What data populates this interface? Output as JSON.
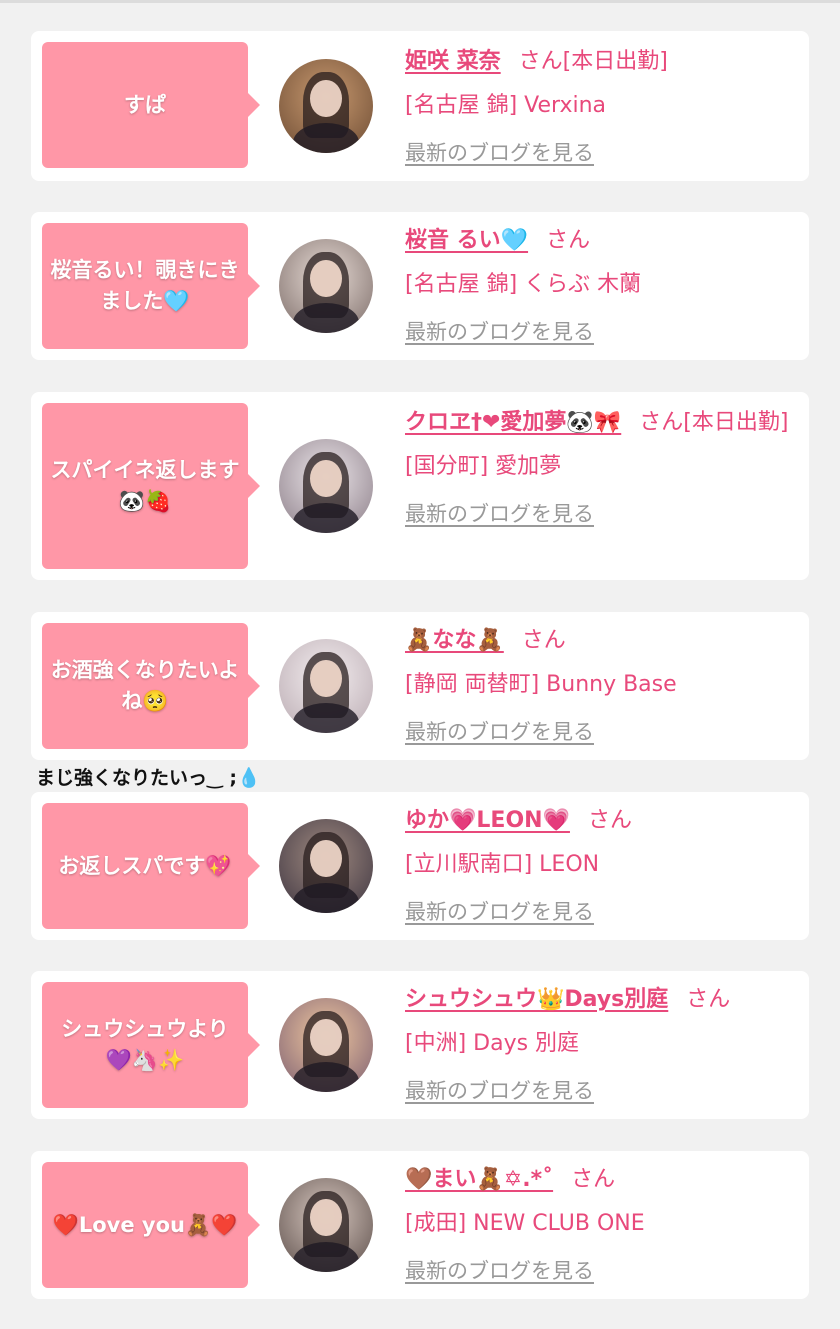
{
  "blog_link_label": "最新のブログを見る",
  "san_label": "さん",
  "extra_comment": "まじ強くなりたいっ‿ ;💧",
  "entries": [
    {
      "bubble": "すぱ",
      "name": "姫咲 菜奈",
      "suffix": "さん[本日出勤]",
      "shop": "[名古屋 錦] Verxina"
    },
    {
      "bubble": "桜音るい！覗きにきました🩵",
      "name": "桜音 るい🩵",
      "suffix": "さん",
      "shop": "[名古屋 錦] くらぶ 木蘭"
    },
    {
      "bubble": "スパイイネ返します🐼🍓",
      "name": "クロヱ†❤愛加夢🐼🎀",
      "suffix": "さん[本日出勤]",
      "shop": "[国分町] 愛加夢"
    },
    {
      "bubble": "お酒強くなりたいよね🥺",
      "name": "🧸なな🧸",
      "suffix": "さん",
      "shop": "[静岡 両替町] Bunny Base"
    },
    {
      "bubble": "お返しスパです💖",
      "name": "ゆか💗LEON💗",
      "suffix": "さん",
      "shop": "[立川駅南口] LEON"
    },
    {
      "bubble": "シュウシュウより💜🦄✨",
      "name": "シュウシュウ👑Days別庭",
      "suffix": "さん",
      "shop": "[中洲] Days 別庭"
    },
    {
      "bubble": "❤️Love you🧸❤️",
      "name": "🤎まい🧸✡.*˚",
      "suffix": "さん",
      "shop": "[成田] NEW CLUB ONE"
    }
  ]
}
